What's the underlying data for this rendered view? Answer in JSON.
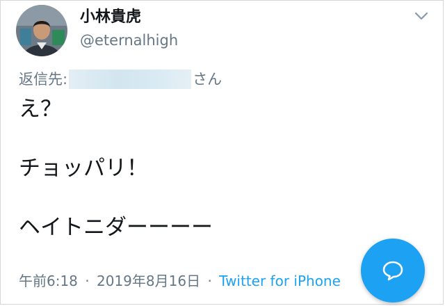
{
  "author": {
    "display_name": "小林貴虎",
    "handle": "@eternalhigh",
    "avatar_icon": "profile-photo"
  },
  "reply_to": {
    "prefix": "返信先:",
    "suffix": "さん"
  },
  "tweet": {
    "lines": [
      "え？",
      "チョッパリ！",
      "ヘイトニダーーーー"
    ]
  },
  "meta": {
    "time": "午前6:18",
    "separator": "·",
    "date": "2019年8月16日",
    "source": "Twitter for iPhone"
  },
  "icons": {
    "menu": "chevron-down-icon",
    "reply_fab": "reply-bubble-icon"
  },
  "colors": {
    "accent": "#1da1f2",
    "secondary_text": "#657786",
    "primary_text": "#14171a"
  }
}
